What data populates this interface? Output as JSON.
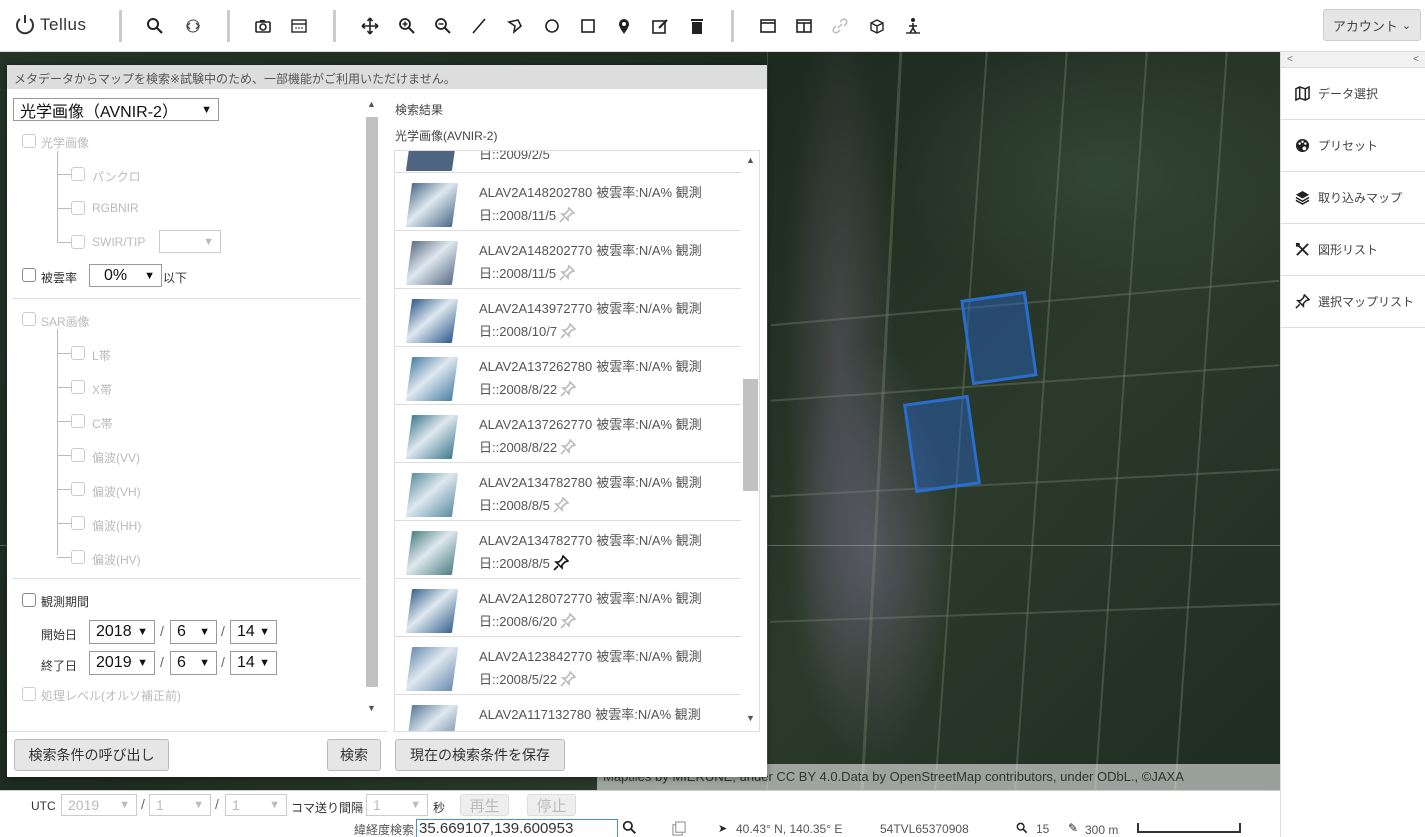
{
  "app": {
    "name": "Tellus"
  },
  "toolbar": {
    "account_label": "アカウント",
    "account_caret": "⌄"
  },
  "sidebar": {
    "collapse_left": "<",
    "collapse_right": "<",
    "items": [
      {
        "label": "データ選択",
        "icon": "map-icon"
      },
      {
        "label": "プリセット",
        "icon": "palette-icon"
      },
      {
        "label": "取り込みマップ",
        "icon": "layers-icon"
      },
      {
        "label": "図形リスト",
        "icon": "draw-tools-icon"
      },
      {
        "label": "選択マップリスト",
        "icon": "pin-icon"
      }
    ]
  },
  "dialog": {
    "header": "メタデータからマップを検索※試験中のため、一部機能がご利用いただけません。",
    "data_type": "光学画像（AVNIR-2）",
    "optical_label": "光学画像",
    "pancro": "パンクロ",
    "rgbnir": "RGBNIR",
    "swir": "SWIR/TIP",
    "cloud_label": "被雲率",
    "cloud_value": "0%",
    "cloud_suffix": "以下",
    "sar_label": "SAR画像",
    "sar_bands": [
      "L帯",
      "X帯",
      "C帯",
      "偏波(VV)",
      "偏波(VH)",
      "偏波(HH)",
      "偏波(HV)"
    ],
    "period_label": "観測期間",
    "start_label": "開始日",
    "end_label": "終了日",
    "start": {
      "year": "2018",
      "month": "6",
      "day": "14"
    },
    "end": {
      "year": "2019",
      "month": "6",
      "day": "14"
    },
    "processing_label": "処理レベル(オルソ補正前)",
    "recall_button": "検索条件の呼び出し",
    "search_button": "検索",
    "save_button": "現在の検索条件を保存",
    "results_title": "検索結果",
    "results_subtitle": "光学画像(AVNIR-2)",
    "partial_row_date": "日::2009/2/5",
    "results": [
      {
        "id": "ALAV2A148202780",
        "info": "被雲率:N/A% 観測",
        "date": "日::2008/11/5",
        "pinned": false,
        "color": "#4a6a8a"
      },
      {
        "id": "ALAV2A148202770",
        "info": "被雲率:N/A% 観測",
        "date": "日::2008/11/5",
        "pinned": false,
        "color": "#5a6e84"
      },
      {
        "id": "ALAV2A143972770",
        "info": "被雲率:N/A% 観測",
        "date": "日::2008/10/7",
        "pinned": false,
        "color": "#2f5a8c"
      },
      {
        "id": "ALAV2A137262780",
        "info": "被雲率:N/A% 観測",
        "date": "日::2008/8/22",
        "pinned": false,
        "color": "#4b7fa5"
      },
      {
        "id": "ALAV2A137262770",
        "info": "被雲率:N/A% 観測",
        "date": "日::2008/8/22",
        "pinned": false,
        "color": "#3f7a8e"
      },
      {
        "id": "ALAV2A134782780",
        "info": "被雲率:N/A% 観測",
        "date": "日::2008/8/5",
        "pinned": false,
        "color": "#5a8ea0"
      },
      {
        "id": "ALAV2A134782770",
        "info": "被雲率:N/A% 観測",
        "date": "日::2008/8/5",
        "pinned": true,
        "color": "#4c7f82"
      },
      {
        "id": "ALAV2A128072770",
        "info": "被雲率:N/A% 観測",
        "date": "日::2008/6/20",
        "pinned": false,
        "color": "#36638f"
      },
      {
        "id": "ALAV2A123842770",
        "info": "被雲率:N/A% 観測",
        "date": "日::2008/5/22",
        "pinned": false,
        "color": "#6a8db0"
      },
      {
        "id": "ALAV2A117132780",
        "info": "被雲率:N/A% 観測",
        "date": "",
        "pinned": false,
        "color": "#5a7a9a"
      }
    ]
  },
  "map": {
    "attribution": "Maptiles by MIERUNE, under CC BY 4.0.Data by OpenStreetMap contributors, under ODbL., ©JAXA"
  },
  "time_bar": {
    "utc": "UTC",
    "year": "2019",
    "month": "1",
    "day": "1",
    "interval_label": "コマ送り間隔",
    "interval": "1",
    "seconds": "秒",
    "play": "再生",
    "stop": "停止"
  },
  "status": {
    "coord_search_label": "緯経度検索",
    "coord_value": "35.669107,139.600953",
    "cursor_latlng": "40.43° N, 140.35° E",
    "grid_code": "54TVL65370908",
    "zoom": "15",
    "scale": "300 m"
  }
}
